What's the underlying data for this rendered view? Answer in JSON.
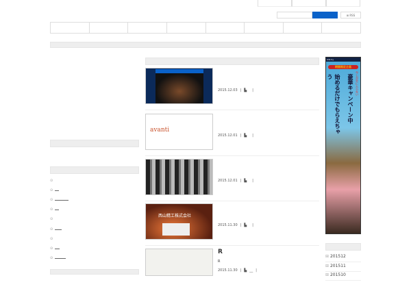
{
  "header": {
    "search_placeholder": "",
    "search_button": "",
    "rss_label": "RSS"
  },
  "nav": {
    "items": [
      "",
      "",
      "",
      "",
      "",
      "",
      "",
      ""
    ]
  },
  "posts": [
    {
      "title": "",
      "excerpt": "",
      "date": "2015.12.03",
      "category": ""
    },
    {
      "title": "",
      "excerpt": "",
      "date": "2015.12.01",
      "category": ""
    },
    {
      "title": "",
      "excerpt": "",
      "date": "2015.12.01",
      "category": ""
    },
    {
      "title": "",
      "excerpt": "",
      "date": "2015.11.30",
      "category": ""
    },
    {
      "title": "R",
      "excerpt": "R",
      "date": "2015.11.30",
      "category": "__"
    }
  ],
  "thumbs": [
    "avanti",
    "西山精工株式会社"
  ],
  "ad": {
    "label": "Ads by",
    "lines": [
      "期間限定企画",
      "今しか手に入らない",
      "豪華キャンペーン中",
      "始めるだけでもらえちゃう"
    ]
  },
  "archives": [
    "201512",
    "201511",
    "201510"
  ],
  "colors": {
    "accent": "#0a62c9"
  }
}
